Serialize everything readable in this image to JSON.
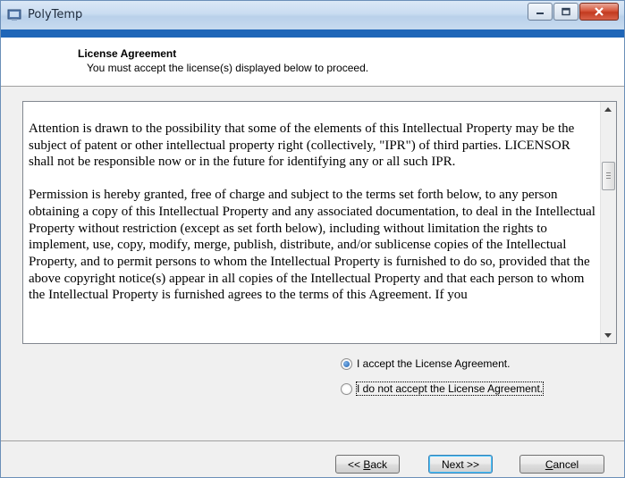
{
  "window": {
    "title": "PolyTemp",
    "caption_buttons": [
      "minimize",
      "maximize",
      "close"
    ]
  },
  "header": {
    "title": "License Agreement",
    "subtitle": "You must accept the license(s) displayed below to proceed."
  },
  "license": {
    "paragraph1": "Attention is drawn to the possibility that some of the elements of this Intellectual Property may be the subject of patent or other intellectual property right (collectively, \"IPR\") of third parties. LICENSOR shall not be responsible now or in the future for identifying any or all such IPR.",
    "paragraph2": "Permission is hereby granted, free of charge and subject to the terms set forth below, to any person obtaining a copy of this Intellectual Property and any associated documentation, to deal in the Intellectual Property without restriction (except as set forth below), including without limitation the rights to implement, use, copy, modify, merge, publish, distribute, and/or sublicense copies of the Intellectual Property, and to permit persons to whom the Intellectual Property is furnished to do so, provided that the above copyright notice(s) appear in all copies of the Intellectual Property and that each person to whom the Intellectual Property is furnished agrees to the terms of this Agreement.  If you"
  },
  "options": {
    "accept_label": "I accept the License Agreement.",
    "decline_label": "I do not accept the License Agreement.",
    "selected": "accept"
  },
  "buttons": {
    "back_prefix": "<< ",
    "back_key": "B",
    "back_rest": "ack",
    "next_label": "Next >>",
    "cancel_key": "C",
    "cancel_rest": "ancel"
  },
  "colors": {
    "accent_strip": "#1f66b8",
    "close_button": "#c23a1f",
    "radio_selected": "#1c5fb0"
  }
}
